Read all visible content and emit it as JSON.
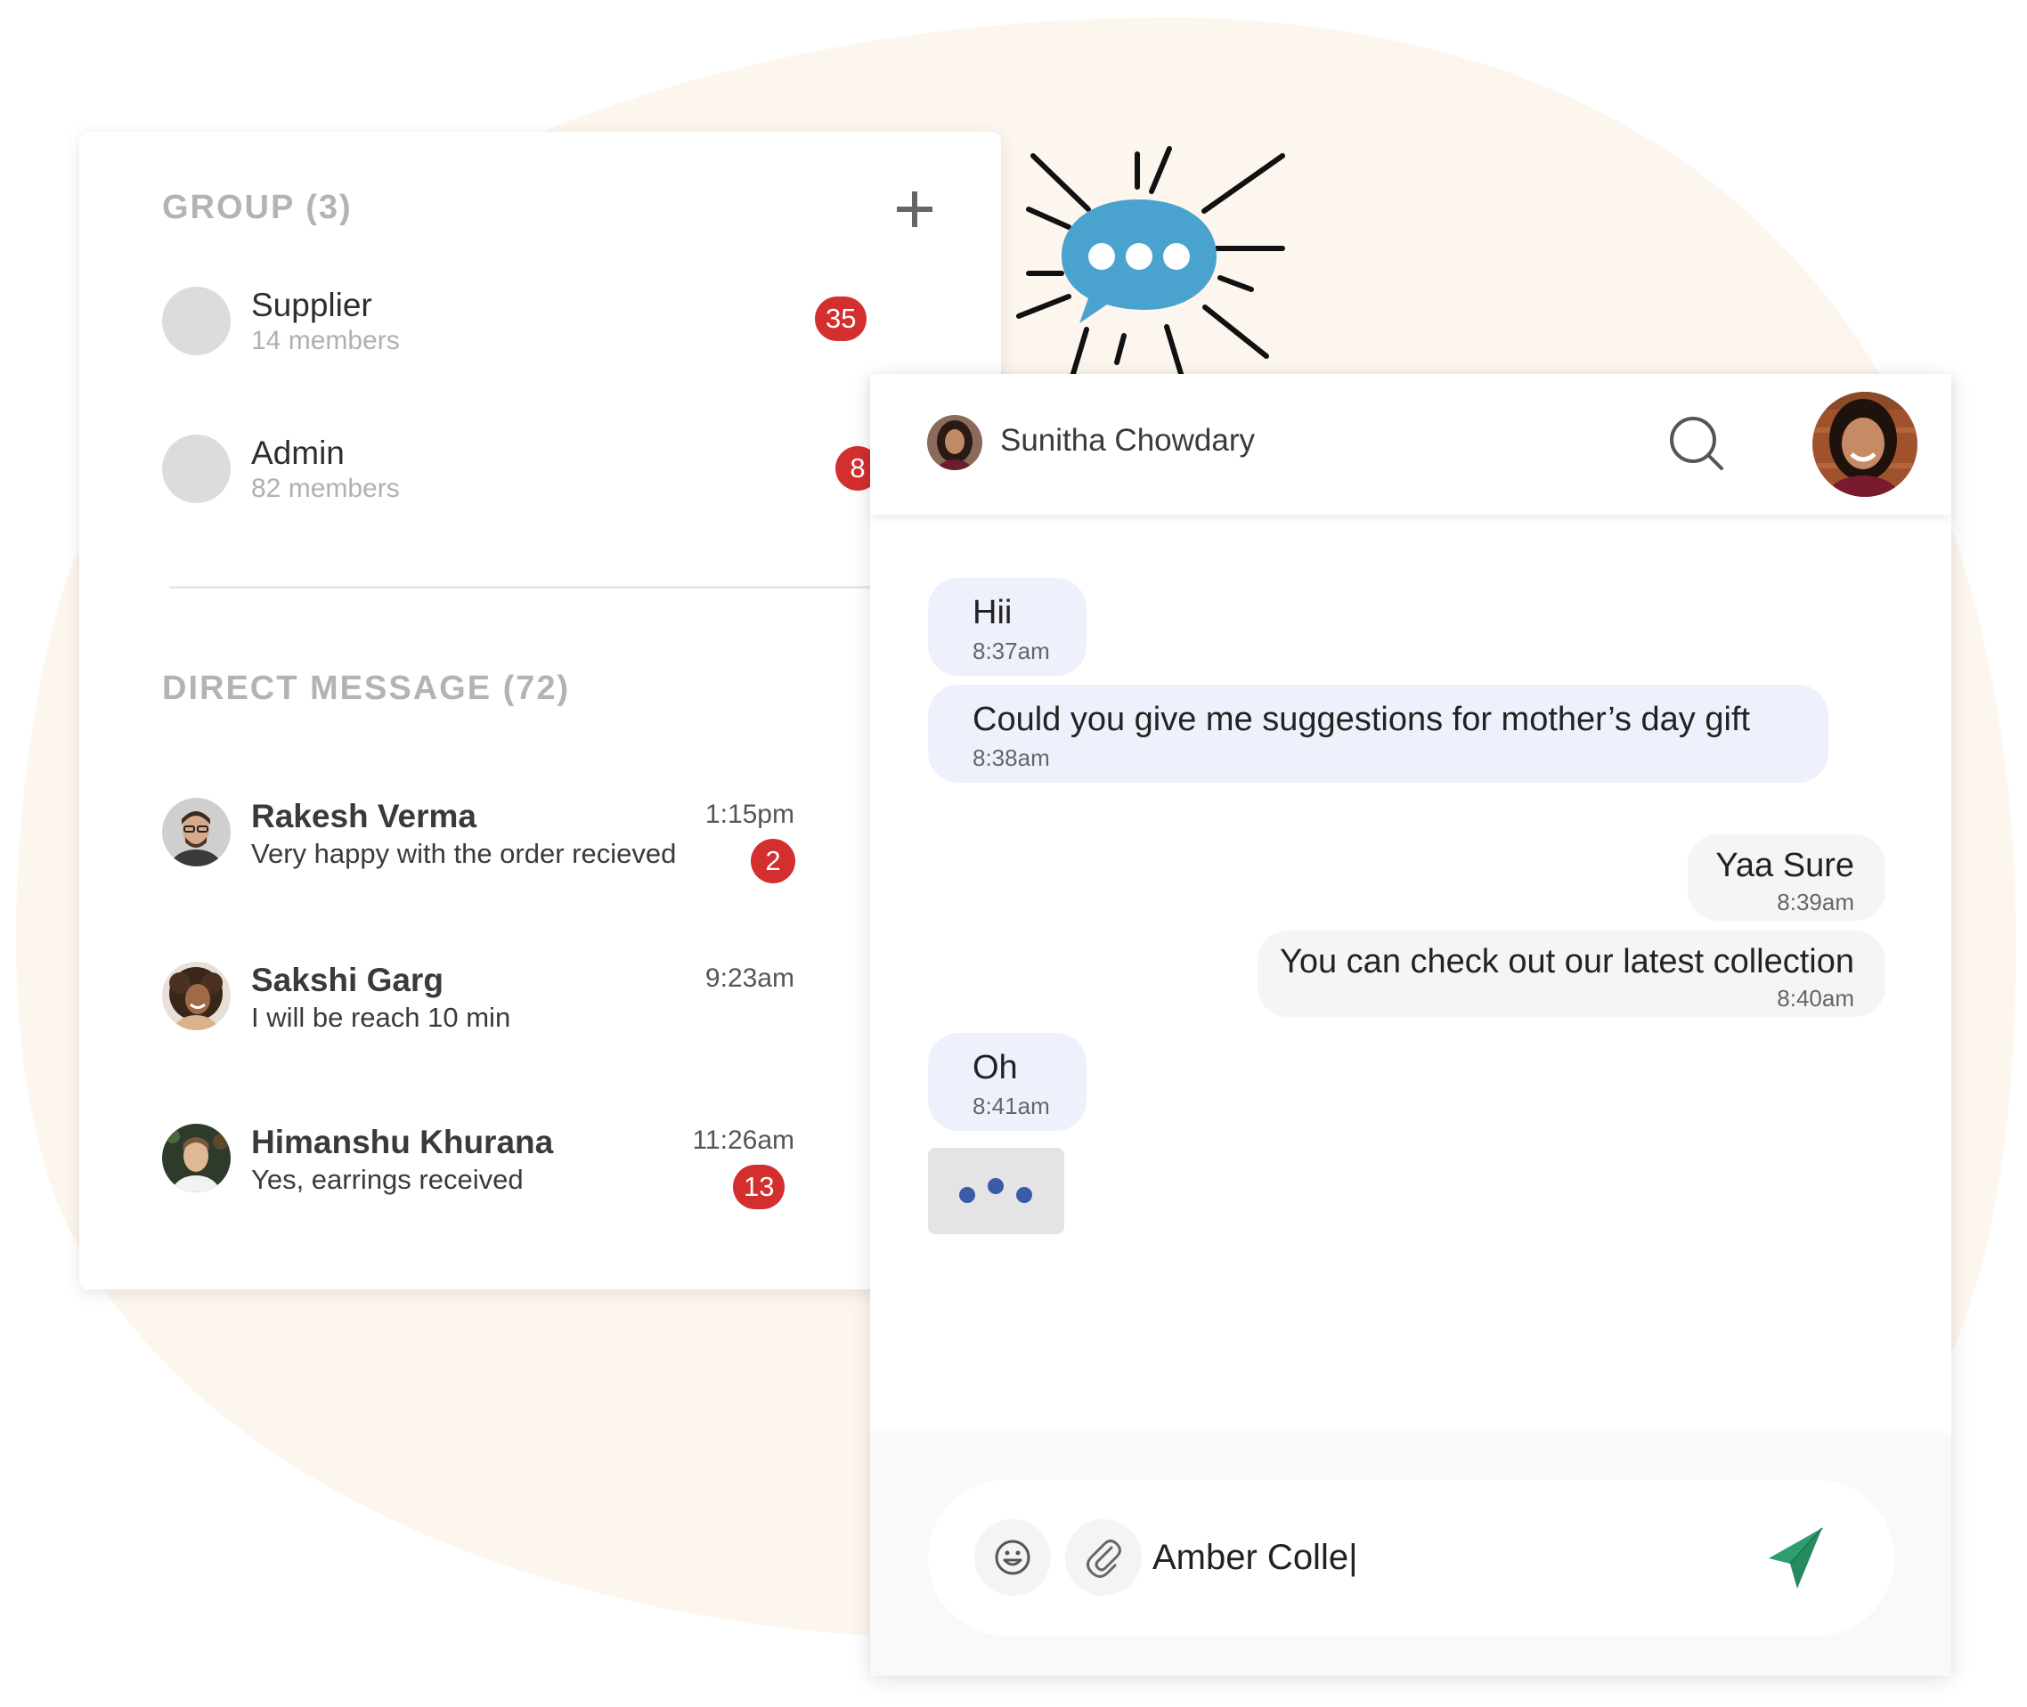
{
  "colors": {
    "badge_red": "#d32f2f",
    "incoming_bubble": "#eef1fb",
    "outgoing_bubble": "#f5f5f7",
    "send_green": "#2e9e6f",
    "typing_dots": "#3b5aa8",
    "chat_icon_blue": "#4aa3cf",
    "background_blob": "#fdf6ee"
  },
  "groups": {
    "title": "GROUP (3)",
    "add_icon": "plus-icon",
    "items": [
      {
        "name": "Supplier",
        "members": "14 members",
        "badge": "35"
      },
      {
        "name": "Admin",
        "members": "82 members",
        "badge": "8"
      }
    ]
  },
  "direct_messages": {
    "title": "DIRECT MESSAGE (72)",
    "items": [
      {
        "name": "Rakesh Verma",
        "message": "Very happy with the order recieved",
        "time": "1:15pm",
        "badge": "2"
      },
      {
        "name": "Sakshi Garg",
        "message": "I will be reach 10 min",
        "time": "9:23am",
        "badge": ""
      },
      {
        "name": "Himanshu Khurana",
        "message": "Yes, earrings received",
        "time": "11:26am",
        "badge": "13"
      }
    ]
  },
  "chat": {
    "contact_name": "Sunitha Chowdary",
    "search_icon": "search-icon",
    "messages": [
      {
        "direction": "in",
        "text": "Hii",
        "time": "8:37am"
      },
      {
        "direction": "in",
        "text": "Could you give me suggestions for mother’s day gift",
        "time": "8:38am"
      },
      {
        "direction": "out",
        "text": "Yaa Sure",
        "time": "8:39am"
      },
      {
        "direction": "out",
        "text": "You can check out our latest collection",
        "time": "8:40am"
      },
      {
        "direction": "in",
        "text": "Oh",
        "time": "8:41am"
      }
    ],
    "typing_indicator": "typing-dots-icon"
  },
  "composer": {
    "value": "Amber Colle|",
    "emoji_icon": "smiley-icon",
    "attach_icon": "paperclip-icon",
    "send_icon": "send-icon"
  },
  "decoration": {
    "icon": "chat-bubble-burst-icon"
  }
}
